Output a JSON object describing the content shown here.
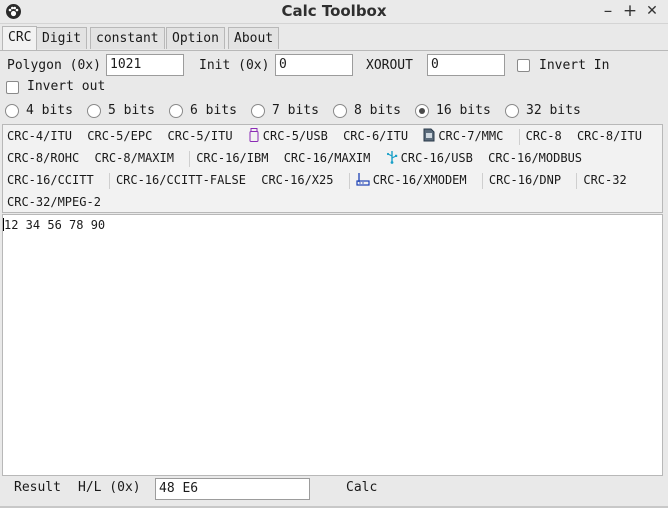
{
  "window": {
    "title": "Calc Toolbox",
    "controls": {
      "minimize": "–",
      "maximize": "+",
      "close": "✕"
    },
    "app_icon": "paw-icon"
  },
  "tabs": [
    "CRC",
    "Digit",
    "constant",
    "Option",
    "About"
  ],
  "active_tab": "CRC",
  "params": {
    "polygon_label": "Polygon (0x)",
    "polygon_value": "1021",
    "init_label": "Init (0x)",
    "init_value": "0",
    "xorout_label": "XOROUT",
    "xorout_value": "0",
    "invert_in_label": "Invert In",
    "invert_out_label": "Invert out"
  },
  "bits": {
    "options": [
      "4 bits",
      "5 bits",
      "6 bits",
      "7 bits",
      "8 bits",
      "16 bits",
      "32 bits"
    ],
    "selected": "16 bits"
  },
  "algorithms": {
    "row1": [
      "CRC-4/ITU",
      "CRC-5/EPC",
      "CRC-5/ITU",
      "CRC-5/USB",
      "CRC-6/ITU",
      "CRC-7/MMC",
      "CRC-8",
      "CRC-8/ITU"
    ],
    "row2": [
      "CRC-8/ROHC",
      "CRC-8/MAXIM",
      "CRC-16/IBM",
      "CRC-16/MAXIM",
      "CRC-16/USB",
      "CRC-16/MODBUS"
    ],
    "row3": [
      "CRC-16/CCITT",
      "CRC-16/CCITT-FALSE",
      "CRC-16/X25",
      "CRC-16/XMODEM",
      "CRC-16/DNP",
      "CRC-32"
    ],
    "row4": [
      "CRC-32/MPEG-2"
    ]
  },
  "input_data": "12 34 56 78 90",
  "result": {
    "label": "Result",
    "hl_label": "H/L (0x)",
    "value": "48 E6",
    "calc_label": "Calc"
  },
  "colors": {
    "usb_icon": "#8b2bb5",
    "usb16_icon": "#1aa0c8",
    "xmodem_icon": "#1a3fb5"
  }
}
